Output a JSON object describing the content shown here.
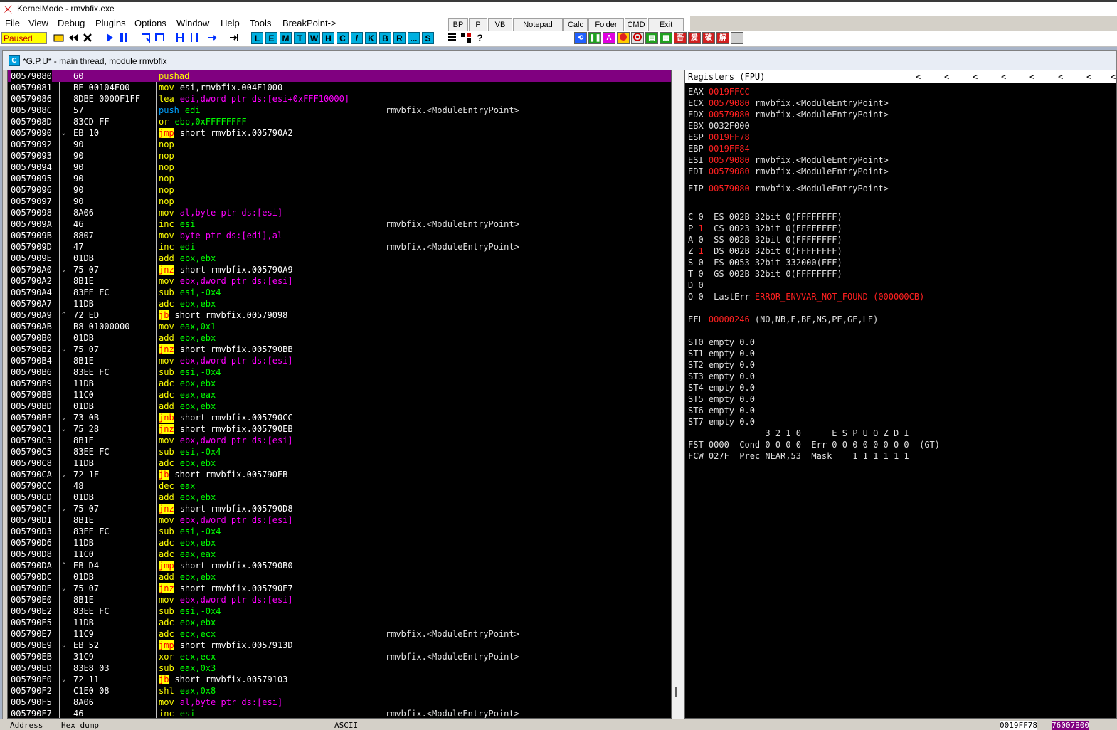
{
  "window": {
    "title": "KernelMode - rmvbfix.exe"
  },
  "menu": [
    "File",
    "View",
    "Debug",
    "Plugins",
    "Options",
    "Window",
    "Help",
    "Tools",
    "BreakPoint->"
  ],
  "quick_buttons": [
    "BP",
    "P",
    "VB",
    "Notepad",
    "Calc",
    "Folder",
    "CMD",
    "Exit"
  ],
  "toolbar": {
    "status": "Paused",
    "letter_buttons": [
      "L",
      "E",
      "M",
      "T",
      "W",
      "H",
      "C",
      "/",
      "K",
      "B",
      "R",
      "...",
      "S"
    ],
    "plugin_glyphs": [
      "吾",
      "爱",
      "破",
      "解"
    ]
  },
  "cpu": {
    "title": "*G.P.U* - main thread, module rmvbfix",
    "title_icon": "C"
  },
  "disasm": [
    {
      "addr": "00579080",
      "arrow": "",
      "hex": "60",
      "m": "pushad",
      "ops": "",
      "cmt": "",
      "sel": true
    },
    {
      "addr": "00579081",
      "arrow": "",
      "hex": "BE 00104F00",
      "m": "mov",
      "ops": "esi,rmvbfix.004F1000",
      "cmt": ""
    },
    {
      "addr": "00579086",
      "arrow": "",
      "hex": "8DBE 0000F1FF",
      "m": "lea",
      "ops": "edi,dword ptr ds:[esi+0xFFF10000]",
      "cmt": ""
    },
    {
      "addr": "0057908C",
      "arrow": "",
      "hex": "57",
      "m": "push",
      "ops": "edi",
      "cmt": "rmvbfix.<ModuleEntryPoint>"
    },
    {
      "addr": "0057908D",
      "arrow": "",
      "hex": "83CD FF",
      "m": "or",
      "ops": "ebp,0xFFFFFFFF",
      "cmt": ""
    },
    {
      "addr": "00579090",
      "arrow": "⌄",
      "hex": "EB 10",
      "m": "jmp",
      "ops": "short rmvbfix.005790A2",
      "cmt": ""
    },
    {
      "addr": "00579092",
      "arrow": "",
      "hex": "90",
      "m": "nop",
      "ops": "",
      "cmt": ""
    },
    {
      "addr": "00579093",
      "arrow": "",
      "hex": "90",
      "m": "nop",
      "ops": "",
      "cmt": ""
    },
    {
      "addr": "00579094",
      "arrow": "",
      "hex": "90",
      "m": "nop",
      "ops": "",
      "cmt": ""
    },
    {
      "addr": "00579095",
      "arrow": "",
      "hex": "90",
      "m": "nop",
      "ops": "",
      "cmt": ""
    },
    {
      "addr": "00579096",
      "arrow": "",
      "hex": "90",
      "m": "nop",
      "ops": "",
      "cmt": ""
    },
    {
      "addr": "00579097",
      "arrow": "",
      "hex": "90",
      "m": "nop",
      "ops": "",
      "cmt": ""
    },
    {
      "addr": "00579098",
      "arrow": "",
      "hex": "8A06",
      "m": "mov",
      "ops": "al,byte ptr ds:[esi]",
      "cmt": ""
    },
    {
      "addr": "0057909A",
      "arrow": "",
      "hex": "46",
      "m": "inc",
      "ops": "esi",
      "cmt": "rmvbfix.<ModuleEntryPoint>"
    },
    {
      "addr": "0057909B",
      "arrow": "",
      "hex": "8807",
      "m": "mov",
      "ops": "byte ptr ds:[edi],al",
      "cmt": ""
    },
    {
      "addr": "0057909D",
      "arrow": "",
      "hex": "47",
      "m": "inc",
      "ops": "edi",
      "cmt": "rmvbfix.<ModuleEntryPoint>"
    },
    {
      "addr": "0057909E",
      "arrow": "",
      "hex": "01DB",
      "m": "add",
      "ops": "ebx,ebx",
      "cmt": ""
    },
    {
      "addr": "005790A0",
      "arrow": "⌄",
      "hex": "75 07",
      "m": "jnz",
      "ops": "short rmvbfix.005790A9",
      "cmt": ""
    },
    {
      "addr": "005790A2",
      "arrow": "",
      "hex": "8B1E",
      "m": "mov",
      "ops": "ebx,dword ptr ds:[esi]",
      "cmt": ""
    },
    {
      "addr": "005790A4",
      "arrow": "",
      "hex": "83EE FC",
      "m": "sub",
      "ops": "esi,-0x4",
      "cmt": ""
    },
    {
      "addr": "005790A7",
      "arrow": "",
      "hex": "11DB",
      "m": "adc",
      "ops": "ebx,ebx",
      "cmt": ""
    },
    {
      "addr": "005790A9",
      "arrow": "^",
      "hex": "72 ED",
      "m": "jb",
      "ops": "short rmvbfix.00579098",
      "cmt": ""
    },
    {
      "addr": "005790AB",
      "arrow": "",
      "hex": "B8 01000000",
      "m": "mov",
      "ops": "eax,0x1",
      "cmt": ""
    },
    {
      "addr": "005790B0",
      "arrow": "",
      "hex": "01DB",
      "m": "add",
      "ops": "ebx,ebx",
      "cmt": ""
    },
    {
      "addr": "005790B2",
      "arrow": "⌄",
      "hex": "75 07",
      "m": "jnz",
      "ops": "short rmvbfix.005790BB",
      "cmt": ""
    },
    {
      "addr": "005790B4",
      "arrow": "",
      "hex": "8B1E",
      "m": "mov",
      "ops": "ebx,dword ptr ds:[esi]",
      "cmt": ""
    },
    {
      "addr": "005790B6",
      "arrow": "",
      "hex": "83EE FC",
      "m": "sub",
      "ops": "esi,-0x4",
      "cmt": ""
    },
    {
      "addr": "005790B9",
      "arrow": "",
      "hex": "11DB",
      "m": "adc",
      "ops": "ebx,ebx",
      "cmt": ""
    },
    {
      "addr": "005790BB",
      "arrow": "",
      "hex": "11C0",
      "m": "adc",
      "ops": "eax,eax",
      "cmt": ""
    },
    {
      "addr": "005790BD",
      "arrow": "",
      "hex": "01DB",
      "m": "add",
      "ops": "ebx,ebx",
      "cmt": ""
    },
    {
      "addr": "005790BF",
      "arrow": "⌄",
      "hex": "73 0B",
      "m": "jnb",
      "ops": "short rmvbfix.005790CC",
      "cmt": ""
    },
    {
      "addr": "005790C1",
      "arrow": "⌄",
      "hex": "75 28",
      "m": "jnz",
      "ops": "short rmvbfix.005790EB",
      "cmt": ""
    },
    {
      "addr": "005790C3",
      "arrow": "",
      "hex": "8B1E",
      "m": "mov",
      "ops": "ebx,dword ptr ds:[esi]",
      "cmt": ""
    },
    {
      "addr": "005790C5",
      "arrow": "",
      "hex": "83EE FC",
      "m": "sub",
      "ops": "esi,-0x4",
      "cmt": ""
    },
    {
      "addr": "005790C8",
      "arrow": "",
      "hex": "11DB",
      "m": "adc",
      "ops": "ebx,ebx",
      "cmt": ""
    },
    {
      "addr": "005790CA",
      "arrow": "⌄",
      "hex": "72 1F",
      "m": "jb",
      "ops": "short rmvbfix.005790EB",
      "cmt": ""
    },
    {
      "addr": "005790CC",
      "arrow": "",
      "hex": "48",
      "m": "dec",
      "ops": "eax",
      "cmt": ""
    },
    {
      "addr": "005790CD",
      "arrow": "",
      "hex": "01DB",
      "m": "add",
      "ops": "ebx,ebx",
      "cmt": ""
    },
    {
      "addr": "005790CF",
      "arrow": "⌄",
      "hex": "75 07",
      "m": "jnz",
      "ops": "short rmvbfix.005790D8",
      "cmt": ""
    },
    {
      "addr": "005790D1",
      "arrow": "",
      "hex": "8B1E",
      "m": "mov",
      "ops": "ebx,dword ptr ds:[esi]",
      "cmt": ""
    },
    {
      "addr": "005790D3",
      "arrow": "",
      "hex": "83EE FC",
      "m": "sub",
      "ops": "esi,-0x4",
      "cmt": ""
    },
    {
      "addr": "005790D6",
      "arrow": "",
      "hex": "11DB",
      "m": "adc",
      "ops": "ebx,ebx",
      "cmt": ""
    },
    {
      "addr": "005790D8",
      "arrow": "",
      "hex": "11C0",
      "m": "adc",
      "ops": "eax,eax",
      "cmt": ""
    },
    {
      "addr": "005790DA",
      "arrow": "^",
      "hex": "EB D4",
      "m": "jmp",
      "ops": "short rmvbfix.005790B0",
      "cmt": ""
    },
    {
      "addr": "005790DC",
      "arrow": "",
      "hex": "01DB",
      "m": "add",
      "ops": "ebx,ebx",
      "cmt": ""
    },
    {
      "addr": "005790DE",
      "arrow": "⌄",
      "hex": "75 07",
      "m": "jnz",
      "ops": "short rmvbfix.005790E7",
      "cmt": ""
    },
    {
      "addr": "005790E0",
      "arrow": "",
      "hex": "8B1E",
      "m": "mov",
      "ops": "ebx,dword ptr ds:[esi]",
      "cmt": ""
    },
    {
      "addr": "005790E2",
      "arrow": "",
      "hex": "83EE FC",
      "m": "sub",
      "ops": "esi,-0x4",
      "cmt": ""
    },
    {
      "addr": "005790E5",
      "arrow": "",
      "hex": "11DB",
      "m": "adc",
      "ops": "ebx,ebx",
      "cmt": ""
    },
    {
      "addr": "005790E7",
      "arrow": "",
      "hex": "11C9",
      "m": "adc",
      "ops": "ecx,ecx",
      "cmt": "rmvbfix.<ModuleEntryPoint>"
    },
    {
      "addr": "005790E9",
      "arrow": "⌄",
      "hex": "EB 52",
      "m": "jmp",
      "ops": "short rmvbfix.0057913D",
      "cmt": ""
    },
    {
      "addr": "005790EB",
      "arrow": "",
      "hex": "31C9",
      "m": "xor",
      "ops": "ecx,ecx",
      "cmt": "rmvbfix.<ModuleEntryPoint>"
    },
    {
      "addr": "005790ED",
      "arrow": "",
      "hex": "83E8 03",
      "m": "sub",
      "ops": "eax,0x3",
      "cmt": ""
    },
    {
      "addr": "005790F0",
      "arrow": "⌄",
      "hex": "72 11",
      "m": "jb",
      "ops": "short rmvbfix.00579103",
      "cmt": ""
    },
    {
      "addr": "005790F2",
      "arrow": "",
      "hex": "C1E0 08",
      "m": "shl",
      "ops": "eax,0x8",
      "cmt": ""
    },
    {
      "addr": "005790F5",
      "arrow": "",
      "hex": "8A06",
      "m": "mov",
      "ops": "al,byte ptr ds:[esi]",
      "cmt": ""
    },
    {
      "addr": "005790F7",
      "arrow": "",
      "hex": "46",
      "m": "inc",
      "ops": "esi",
      "cmt": "rmvbfix.<ModuleEntryPoint>"
    }
  ],
  "registers": {
    "header": "Registers (FPU)",
    "nav": [
      "<",
      "<",
      "<",
      "<",
      "<",
      "<",
      "<",
      "<"
    ],
    "lines": [
      [
        {
          "t": "EAX "
        },
        {
          "t": "0019FFCC",
          "c": "red"
        }
      ],
      [
        {
          "t": "ECX "
        },
        {
          "t": "00579080",
          "c": "red"
        },
        {
          "t": " rmvbfix.<ModuleEntryPoint>"
        }
      ],
      [
        {
          "t": "EDX "
        },
        {
          "t": "00579080",
          "c": "red"
        },
        {
          "t": " rmvbfix.<ModuleEntryPoint>"
        }
      ],
      [
        {
          "t": "EBX 0032F000"
        }
      ],
      [
        {
          "t": "ESP "
        },
        {
          "t": "0019FF78",
          "c": "red"
        }
      ],
      [
        {
          "t": "EBP "
        },
        {
          "t": "0019FF84",
          "c": "red"
        }
      ],
      [
        {
          "t": "ESI "
        },
        {
          "t": "00579080",
          "c": "red"
        },
        {
          "t": " rmvbfix.<ModuleEntryPoint>"
        }
      ],
      [
        {
          "t": "EDI "
        },
        {
          "t": "00579080",
          "c": "red"
        },
        {
          "t": " rmvbfix.<ModuleEntryPoint>"
        }
      ],
      [
        {
          "t": ""
        }
      ],
      [
        {
          "t": "EIP "
        },
        {
          "t": "00579080",
          "c": "red"
        },
        {
          "t": " rmvbfix.<ModuleEntryPoint>"
        }
      ],
      [
        {
          "t": ""
        }
      ],
      [
        {
          "t": "C 0  ES 002B 32bit 0(FFFFFFFF)"
        }
      ],
      [
        {
          "t": "P "
        },
        {
          "t": "1",
          "c": "red"
        },
        {
          "t": "  CS 0023 32bit 0(FFFFFFFF)"
        }
      ],
      [
        {
          "t": "A 0  SS 002B 32bit 0(FFFFFFFF)"
        }
      ],
      [
        {
          "t": "Z "
        },
        {
          "t": "1",
          "c": "red"
        },
        {
          "t": "  DS 002B 32bit 0(FFFFFFFF)"
        }
      ],
      [
        {
          "t": "S 0  FS 0053 32bit 332000(FFF)"
        }
      ],
      [
        {
          "t": "T 0  GS 002B 32bit 0(FFFFFFFF)"
        }
      ],
      [
        {
          "t": "D 0"
        }
      ],
      [
        {
          "t": "O 0  LastErr "
        },
        {
          "t": "ERROR_ENVVAR_NOT_FOUND (000000CB)",
          "c": "red"
        }
      ],
      [
        {
          "t": ""
        }
      ],
      [
        {
          "t": "EFL "
        },
        {
          "t": "00000246",
          "c": "red"
        },
        {
          "t": " (NO,NB,E,BE,NS,PE,GE,LE)"
        }
      ],
      [
        {
          "t": ""
        }
      ],
      [
        {
          "t": "ST0 empty 0.0"
        }
      ],
      [
        {
          "t": "ST1 empty 0.0"
        }
      ],
      [
        {
          "t": "ST2 empty 0.0"
        }
      ],
      [
        {
          "t": "ST3 empty 0.0"
        }
      ],
      [
        {
          "t": "ST4 empty 0.0"
        }
      ],
      [
        {
          "t": "ST5 empty 0.0"
        }
      ],
      [
        {
          "t": "ST6 empty 0.0"
        }
      ],
      [
        {
          "t": "ST7 empty 0.0"
        }
      ],
      [
        {
          "t": "               3 2 1 0      E S P U O Z D I"
        }
      ],
      [
        {
          "t": "FST 0000  Cond 0 0 0 0  Err 0 0 0 0 0 0 0 0  (GT)"
        }
      ],
      [
        {
          "t": "FCW 027F  Prec NEAR,53  Mask    1 1 1 1 1 1"
        }
      ]
    ]
  },
  "bottom": {
    "address_header": "Address",
    "hex_header": "Hex dump",
    "ascii_header": "ASCII",
    "stack_addr": "0019FF78",
    "stack_val": "76007B00"
  }
}
